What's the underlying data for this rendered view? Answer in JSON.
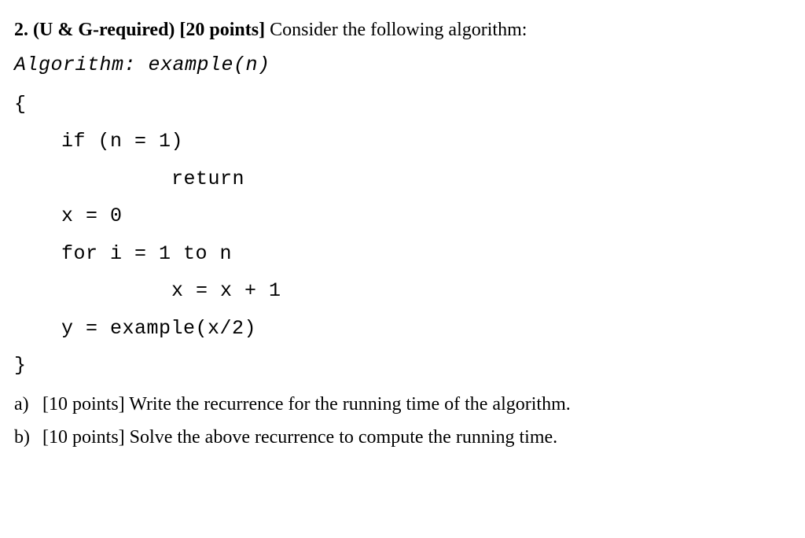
{
  "question": {
    "number": "2.",
    "tag": "(U & G-required)",
    "points": "[20 points]",
    "prompt": "Consider the following algorithm:"
  },
  "algorithm": {
    "title": "Algorithm: example(n)",
    "open_brace": "{",
    "lines": {
      "l1": "if (n = 1)",
      "l2": "return",
      "l3": "x = 0",
      "l4": "for i = 1 to n",
      "l5": "x = x + 1",
      "l6": "y = example(x/2)"
    },
    "close_brace": "}"
  },
  "parts": {
    "a": {
      "label": "a)",
      "points": "[10 points]",
      "text": "Write the recurrence for the running time of the algorithm."
    },
    "b": {
      "label": "b)",
      "points": "[10 points]",
      "text": "Solve the above recurrence to compute the running time."
    }
  }
}
